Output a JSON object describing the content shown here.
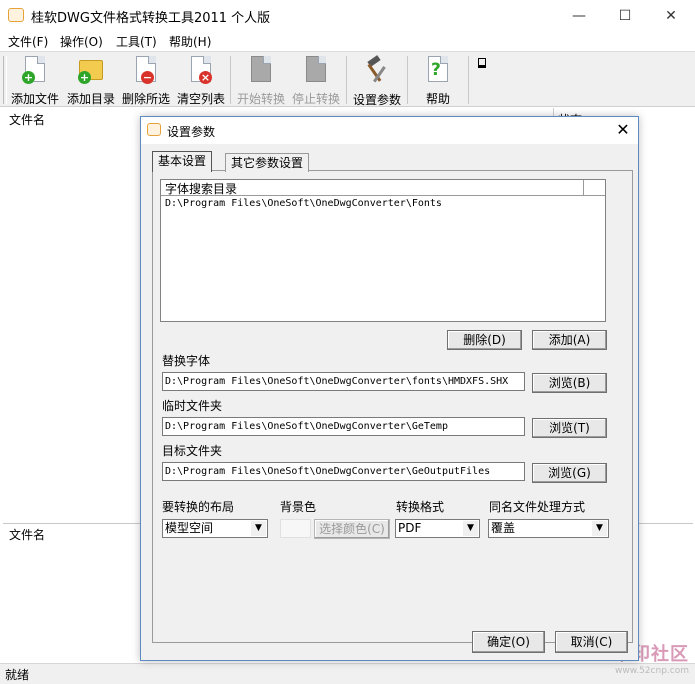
{
  "window": {
    "title": "桂软DWG文件格式转换工具2011 个人版",
    "controls": {
      "minimize": "—",
      "maximize": "☐",
      "close": "✕"
    }
  },
  "menu": [
    "文件(F)",
    "操作(O)",
    "工具(T)",
    "帮助(H)"
  ],
  "toolbar": {
    "add_file": "添加文件",
    "add_folder": "添加目录",
    "delete_selected": "删除所选",
    "clear_list": "清空列表",
    "start_convert": "开始转换",
    "stop_convert": "停止转换",
    "settings": "设置参数",
    "help": "帮助"
  },
  "list": {
    "col_filename": "文件名",
    "col_status": "状态"
  },
  "lower_list": {
    "col_filename": "文件名"
  },
  "status_bar": {
    "text": "就绪"
  },
  "watermark": {
    "text": "华印社区",
    "url": "www.52cnp.com"
  },
  "dialog": {
    "title": "设置参数",
    "close": "✕",
    "tabs": [
      "基本设置",
      "其它参数设置"
    ],
    "font_dirs": {
      "header": "字体搜索目录",
      "items": [
        "D:\\Program Files\\OneSoft\\OneDwgConverter\\Fonts"
      ]
    },
    "delete_button": "删除(D)",
    "add_button": "添加(A)",
    "replace_font": {
      "label": "替换字体",
      "value": "D:\\Program Files\\OneSoft\\OneDwgConverter\\fonts\\HMDXFS.SHX",
      "browse": "浏览(B)"
    },
    "temp_folder": {
      "label": "临时文件夹",
      "value": "D:\\Program Files\\OneSoft\\OneDwgConverter\\GeTemp",
      "browse": "浏览(T)"
    },
    "target_folder": {
      "label": "目标文件夹",
      "value": "D:\\Program Files\\OneSoft\\OneDwgConverter\\GeOutputFiles",
      "browse": "浏览(G)"
    },
    "layout": {
      "label": "要转换的布局",
      "value": "模型空间"
    },
    "background": {
      "label": "背景色",
      "button": "选择颜色(C)"
    },
    "format": {
      "label": "转换格式",
      "value": "PDF"
    },
    "same_name": {
      "label": "同名文件处理方式",
      "value": "覆盖"
    },
    "ok": "确定(O)",
    "cancel": "取消(C)"
  }
}
